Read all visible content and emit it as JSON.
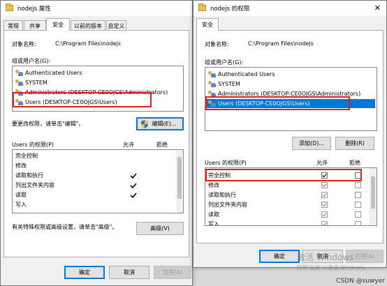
{
  "left_window": {
    "title": "nodejs 属性",
    "tabs": [
      "常规",
      "共享",
      "安全",
      "以前的版本",
      "自定义"
    ],
    "active_tab": "安全",
    "object_name_label": "对象名称:",
    "object_name_value": "C:\\Program Files\\nodejs",
    "group_label": "组或用户名(G):",
    "users": [
      "Authenticated Users",
      "SYSTEM",
      "Administrators (DESKTOP-CE0OJGS\\Administrators)",
      "Users (DESKTOP-CE0OJGS\\Users)"
    ],
    "edit_prompt": "要更改权限，请单击\"编辑\"。",
    "edit_button": "编辑(E)...",
    "perm_label": "Users 的权限(P)",
    "allow_label": "允许",
    "deny_label": "拒绝",
    "permissions": [
      {
        "name": "完全控制",
        "allow": false,
        "deny": false
      },
      {
        "name": "修改",
        "allow": false,
        "deny": false
      },
      {
        "name": "读取和执行",
        "allow": true,
        "deny": false
      },
      {
        "name": "列出文件夹内容",
        "allow": true,
        "deny": false
      },
      {
        "name": "读取",
        "allow": true,
        "deny": false
      },
      {
        "name": "写入",
        "allow": false,
        "deny": false
      }
    ],
    "advanced_prompt": "有关特殊权限或高级设置，请单击\"高级\"。",
    "advanced_button": "高级(V)",
    "ok_button": "确定",
    "cancel_button": "取消",
    "apply_button": "应用(A)"
  },
  "right_window": {
    "title": "nodejs 的权限",
    "close_glyph": "✕",
    "tab": "安全",
    "object_name_label": "对象名称:",
    "object_name_value": "C:\\Program Files\\nodejs",
    "group_label": "组或用户名(G):",
    "users": [
      "Authenticated Users",
      "SYSTEM",
      "Administrators (DESKTOP-CE0OJGS\\Administrators)",
      "Users (DESKTOP-CE0OJGS\\Users)"
    ],
    "add_button": "添加(D)...",
    "remove_button": "删除(R)",
    "perm_label": "Users 的权限(P)",
    "allow_label": "允许",
    "deny_label": "拒绝",
    "permissions": [
      {
        "name": "完全控制",
        "allow": true,
        "deny": false
      },
      {
        "name": "修改",
        "allow": true,
        "deny": false
      },
      {
        "name": "读取和执行",
        "allow": true,
        "deny": false
      },
      {
        "name": "列出文件夹内容",
        "allow": true,
        "deny": false
      },
      {
        "name": "读取",
        "allow": true,
        "deny": false
      },
      {
        "name": "写入",
        "allow": true,
        "deny": false
      }
    ],
    "ok_button": "确定",
    "cancel_button": "取消",
    "apply_button": "应用(A)"
  },
  "watermark": {
    "line1": "激活 Windows",
    "line2": "转到\"设置\"以激活 Windows。"
  },
  "csdn_credit": "CSDN @suwyer",
  "colors": {
    "selection": "#0078d7",
    "highlight_box": "#e02020"
  }
}
